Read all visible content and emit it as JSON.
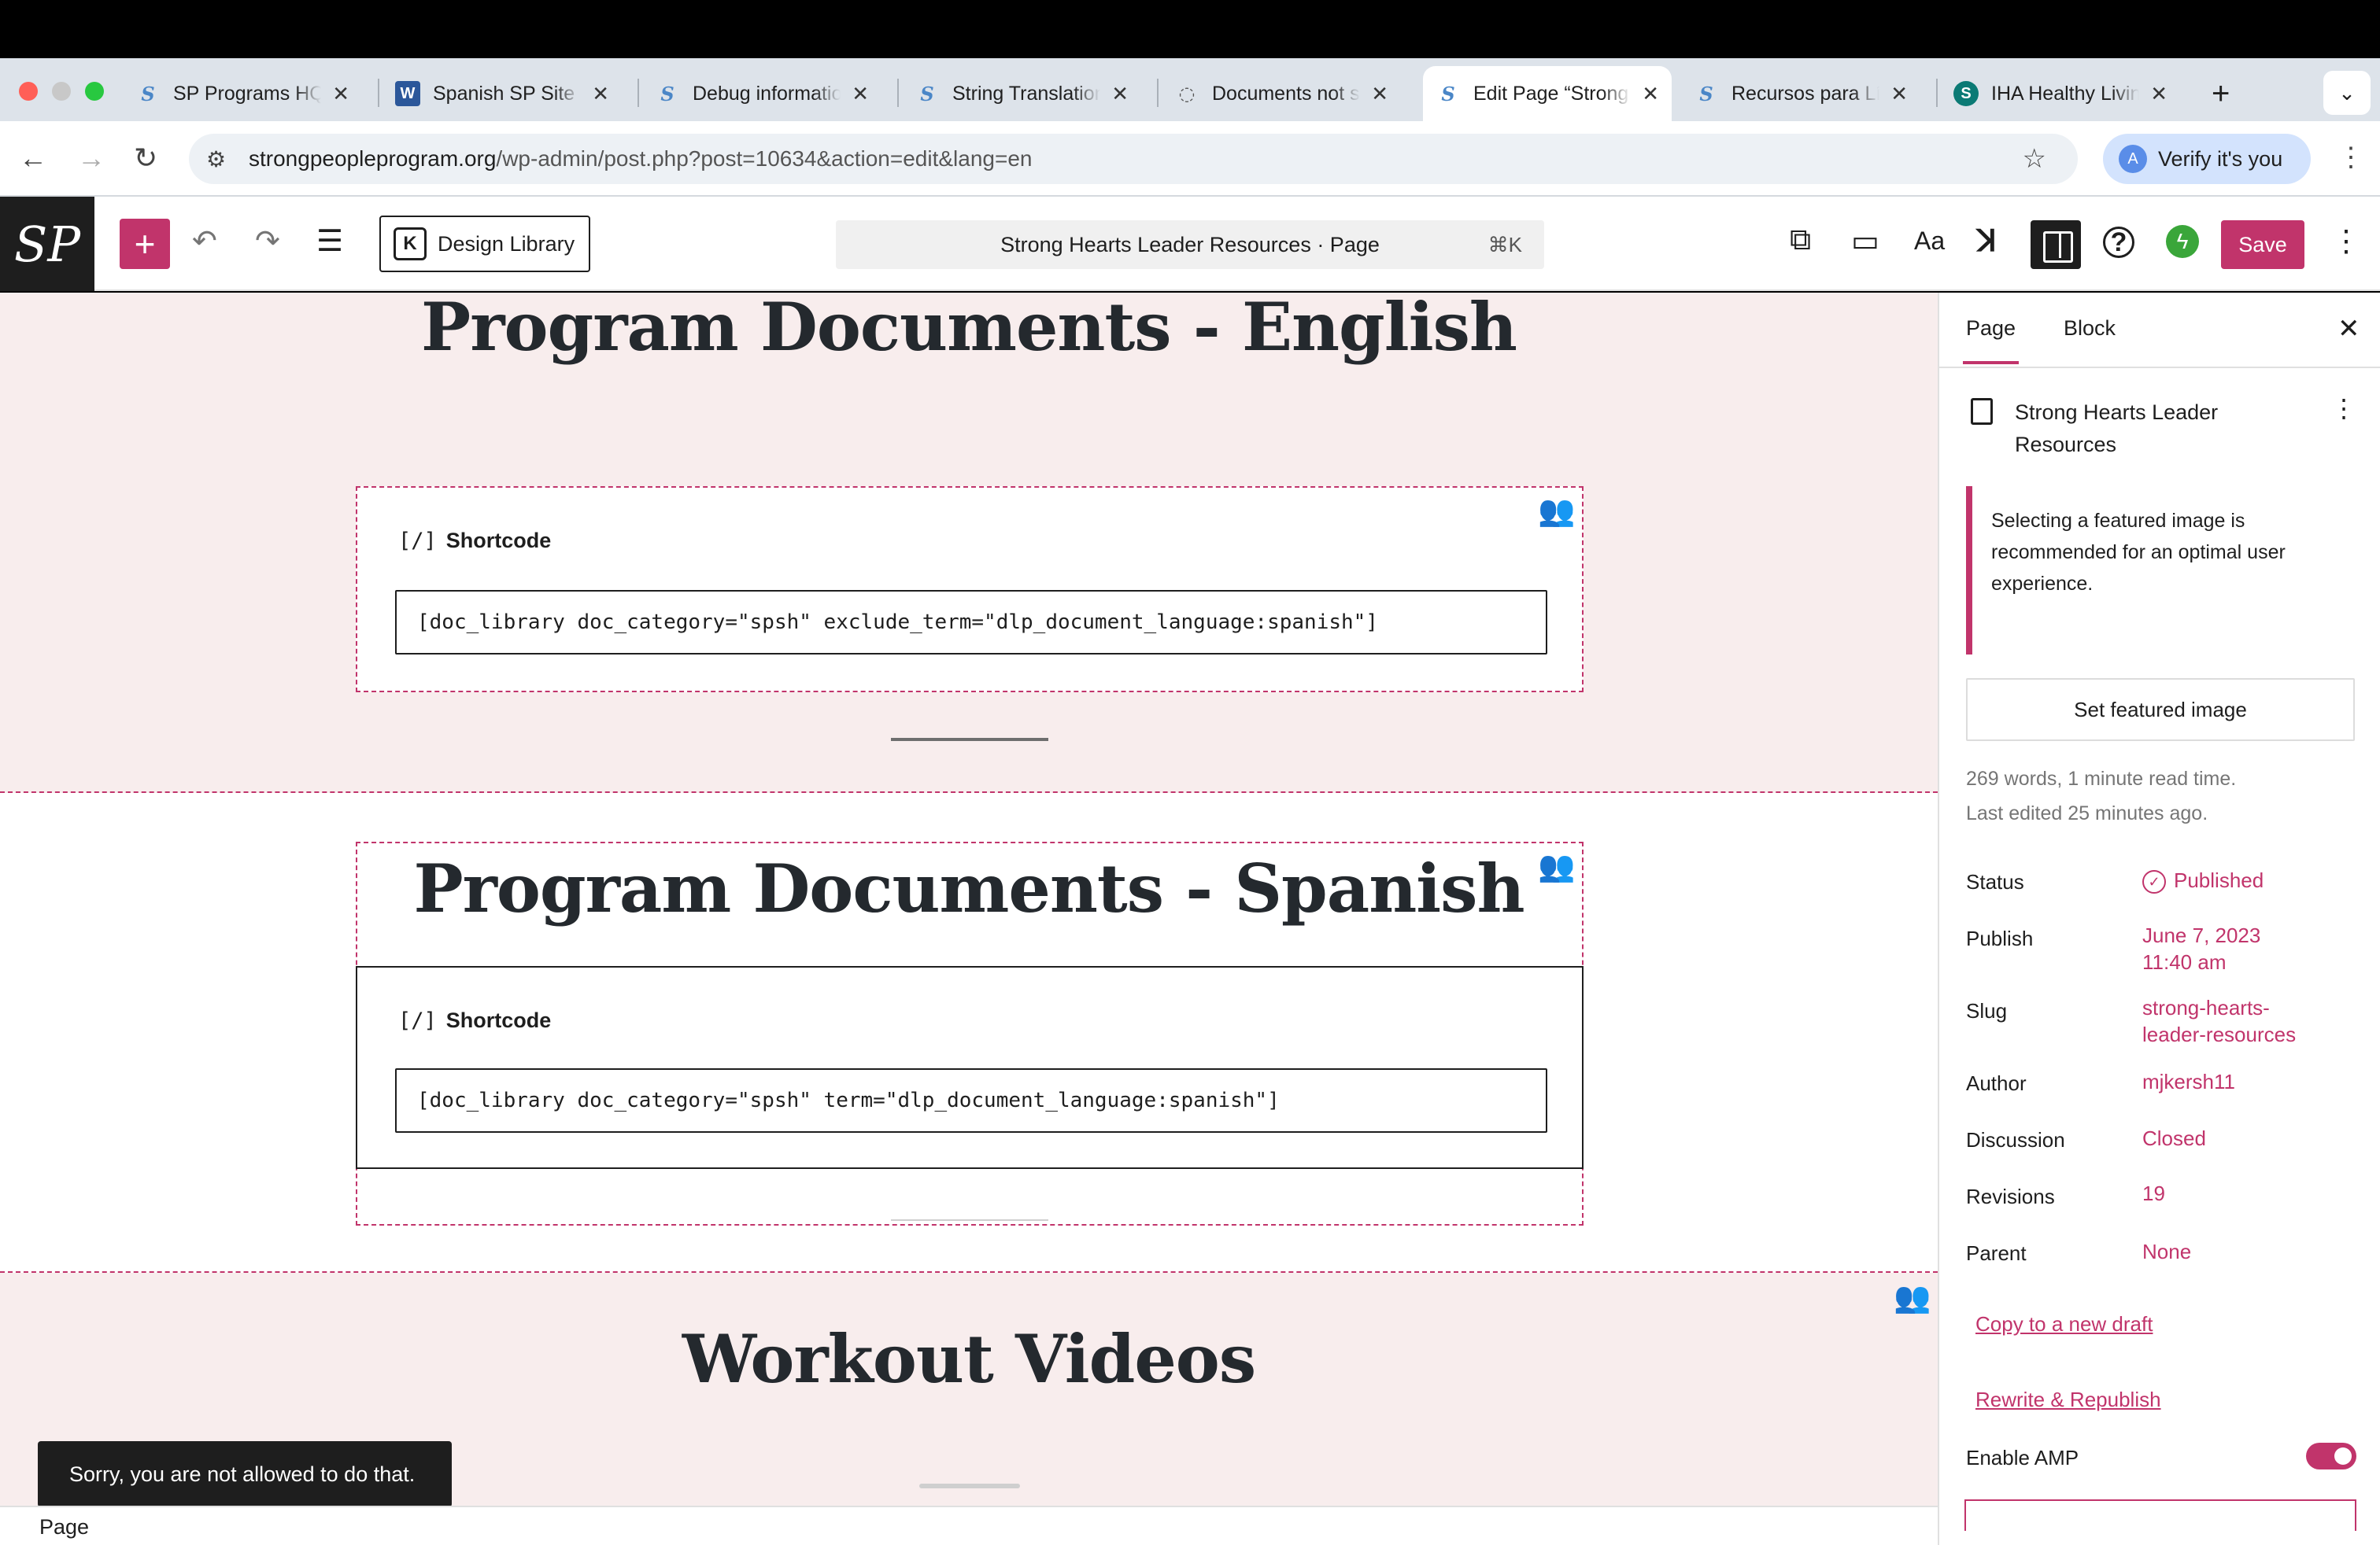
{
  "browser": {
    "tabs": [
      {
        "title": "SP Programs HQ",
        "favicon": "sp-logo-icon"
      },
      {
        "title": "Spanish SP Site (",
        "favicon": "word-icon"
      },
      {
        "title": "Debug information",
        "favicon": "sp-logo-icon"
      },
      {
        "title": "String Translation",
        "favicon": "sp-logo-icon"
      },
      {
        "title": "Documents not s",
        "favicon": "loading-icon"
      },
      {
        "title": "Edit Page “Strong",
        "favicon": "sp-logo-icon"
      },
      {
        "title": "Recursos para Lí",
        "favicon": "sp-logo-icon"
      },
      {
        "title": "IHA Healthy Living",
        "favicon": "sharepoint-icon"
      }
    ],
    "url_host": "strongpeopleprogram.org",
    "url_path": "/wp-admin/post.php?post=10634&action=edit&lang=en",
    "verify_label": "Verify it's you"
  },
  "toolbar": {
    "logo_text": "SP",
    "design_library_label": "Design Library",
    "command_title": "Strong Hearts Leader Resources · Page",
    "command_shortcut": "⌘K",
    "typography_label": "Aa",
    "save_label": "Save"
  },
  "canvas": {
    "heading_english": "Program Documents - English",
    "heading_spanish": "Program Documents - Spanish",
    "heading_workout": "Workout Videos",
    "shortcode_label": "Shortcode",
    "shortcode_icon": "[/]",
    "shortcode_english": "[doc_library doc_category=\"spsh\" exclude_term=\"dlp_document_language:spanish\"]",
    "shortcode_spanish": "[doc_library doc_category=\"spsh\" term=\"dlp_document_language:spanish\"]",
    "snackbar": "Sorry, you are not allowed to do that.",
    "footer_breadcrumb": "Page"
  },
  "sidebar": {
    "tab_page": "Page",
    "tab_block": "Block",
    "doc_title": "Strong Hearts Leader Resources",
    "notice": "Selecting a featured image is recommended for an optimal user experience.",
    "featured_button": "Set featured image",
    "word_count": "269 words, 1 minute read time.",
    "last_edited": "Last edited 25 minutes ago.",
    "fields": {
      "status_label": "Status",
      "status_value": "Published",
      "publish_label": "Publish",
      "publish_value_date": "June 7, 2023",
      "publish_value_time": "11:40 am",
      "slug_label": "Slug",
      "slug_value_1": "strong-hearts-",
      "slug_value_2": "leader-resources",
      "author_label": "Author",
      "author_value": "mjkersh11",
      "discussion_label": "Discussion",
      "discussion_value": "Closed",
      "revisions_label": "Revisions",
      "revisions_value": "19",
      "parent_label": "Parent",
      "parent_value": "None"
    },
    "copy_draft": "Copy to a new draft",
    "rewrite_republish": "Rewrite & Republish",
    "amp_label": "Enable AMP",
    "amp_enabled": true
  },
  "colors": {
    "accent": "#c1346b",
    "pink_band": "#f8eded",
    "toolbar_dark": "#1e1e1e"
  }
}
